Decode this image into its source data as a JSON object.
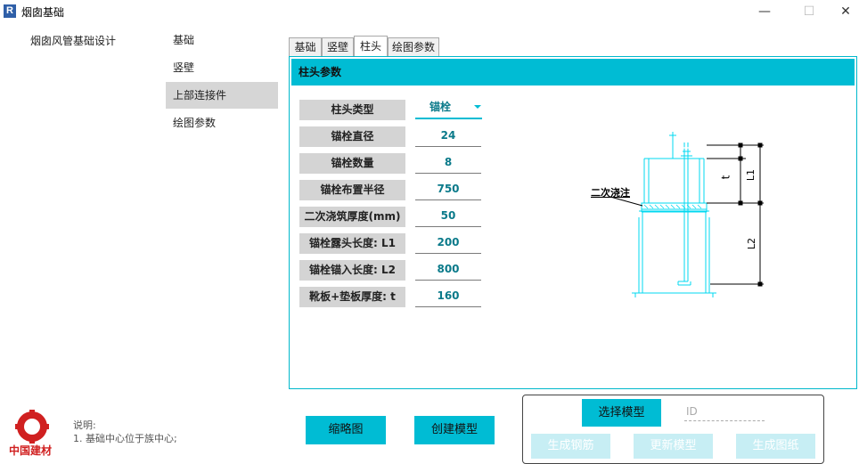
{
  "window": {
    "title": "烟囱基础",
    "app_icon": "R",
    "minimize": "—",
    "maximize": "☐",
    "close": "✕"
  },
  "nav": {
    "root": "烟囱风管基础设计",
    "items": [
      {
        "label": "基础",
        "active": false
      },
      {
        "label": "竖壁",
        "active": false
      },
      {
        "label": "上部连接件",
        "active": true
      },
      {
        "label": "绘图参数",
        "active": false
      }
    ]
  },
  "tabs": [
    {
      "label": "基础",
      "active": false
    },
    {
      "label": "竖壁",
      "active": false
    },
    {
      "label": "柱头",
      "active": true
    },
    {
      "label": "绘图参数",
      "active": false
    }
  ],
  "panel": {
    "title": "柱头参数",
    "type_label": "柱头类型",
    "type_value": "锚栓",
    "params": [
      {
        "label": "锚栓直径",
        "value": "24"
      },
      {
        "label": "锚栓数量",
        "value": "8"
      },
      {
        "label": "锚栓布置半径",
        "value": "750"
      },
      {
        "label": "二次浇筑厚度(mm)",
        "value": "50"
      },
      {
        "label": "锚栓露头长度: L1",
        "value": "200"
      },
      {
        "label": "锚栓锚入长度: L2",
        "value": "800"
      },
      {
        "label": "靴板+垫板厚度: t",
        "value": "160"
      }
    ]
  },
  "diagram": {
    "grout_label": "二次浇注",
    "dim_t": "t",
    "dim_l1": "L1",
    "dim_l2": "L2"
  },
  "footer": {
    "logo_text": "中国建材",
    "note_title": "说明:",
    "note_line": "1. 基础中心位于族中心;",
    "thumb_button": "缩略图",
    "create_button": "创建模型",
    "select_button": "选择模型",
    "id_placeholder": "ID",
    "rebar_button": "生成钢筋",
    "update_button": "更新模型",
    "drawing_button": "生成图纸"
  },
  "colors": {
    "accent": "#00bcd4",
    "disabled": "#c7eef4",
    "logo": "#d02020"
  }
}
